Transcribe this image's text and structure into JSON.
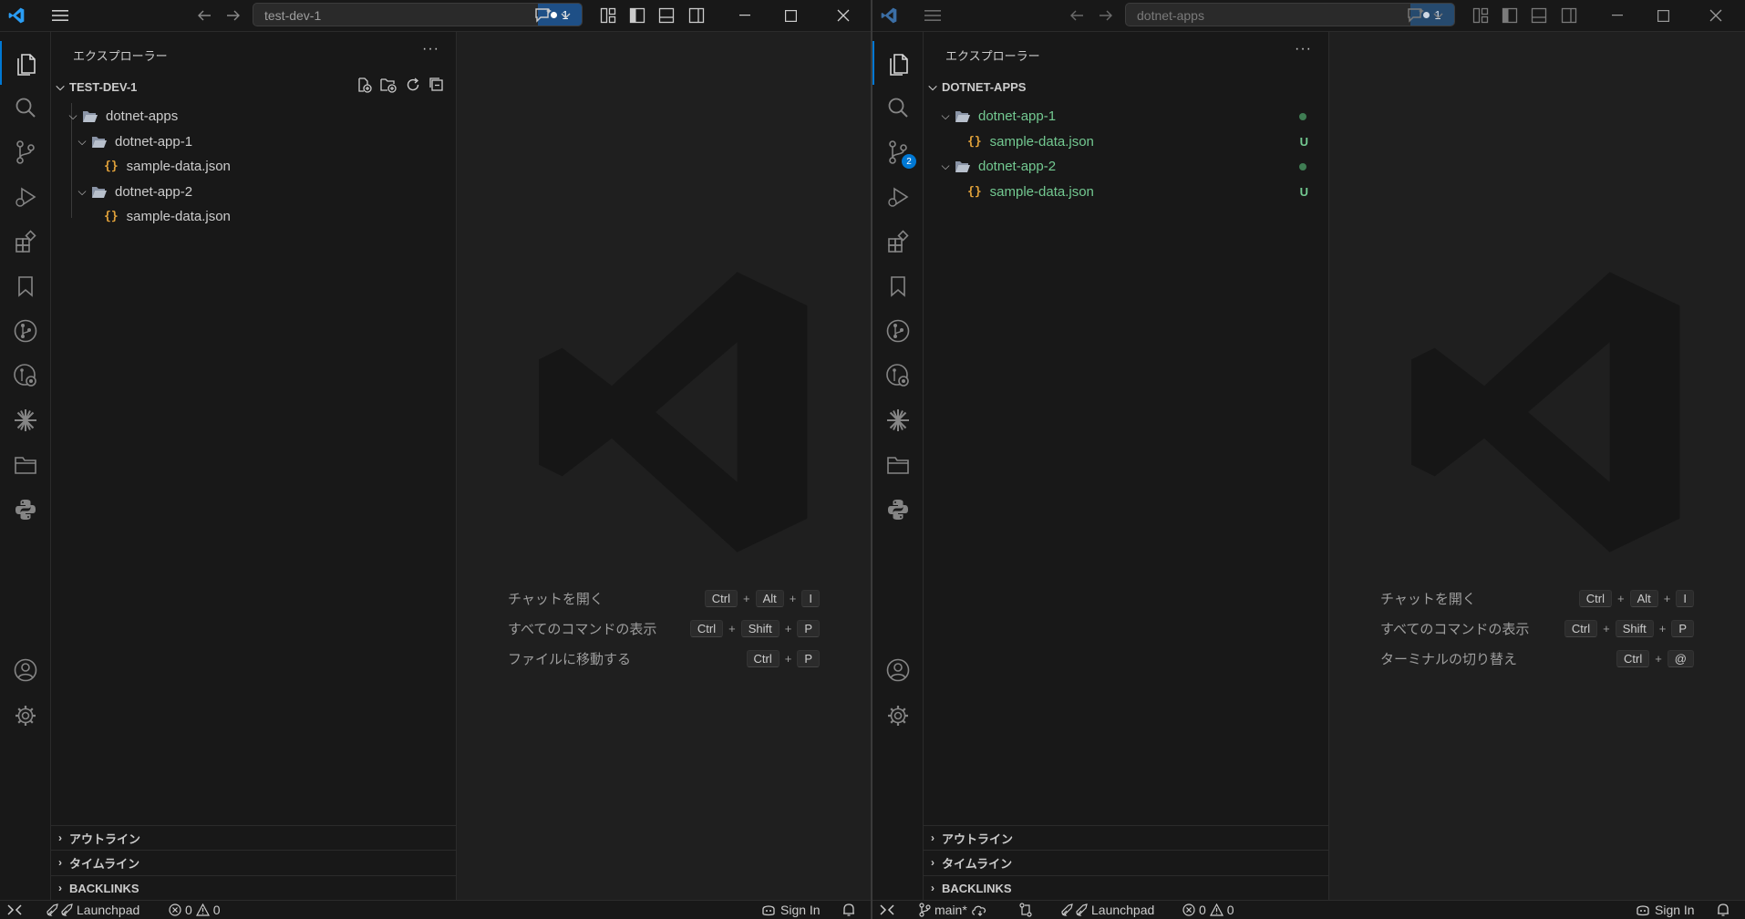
{
  "left": {
    "search_text": "test-dev-1",
    "chat_badge_count": "1",
    "sidebar_title": "エクスプローラー",
    "more": "···",
    "root_folder": "TEST-DEV-1",
    "tree": {
      "f0": "dotnet-apps",
      "f1": "dotnet-app-1",
      "f1_file": "sample-data.json",
      "f2": "dotnet-app-2",
      "f2_file": "sample-data.json"
    },
    "bottom_sections": [
      "アウトライン",
      "タイムライン",
      "BACKLINKS"
    ],
    "shortcuts": [
      {
        "label": "チャットを開く",
        "k1": "Ctrl",
        "k2": "Alt",
        "k3": "I"
      },
      {
        "label": "すべてのコマンドの表示",
        "k1": "Ctrl",
        "k2": "Shift",
        "k3": "P"
      },
      {
        "label": "ファイルに移動する",
        "k1": "Ctrl",
        "k2": "P"
      }
    ],
    "status": {
      "launchpad": "Launchpad",
      "errors": "0",
      "warnings": "0",
      "signin": "Sign In"
    }
  },
  "right": {
    "search_text": "dotnet-apps",
    "chat_badge_count": "1",
    "sidebar_title": "エクスプローラー",
    "more": "···",
    "root_folder": "DOTNET-APPS",
    "scm_badge": "2",
    "tree": {
      "f1": "dotnet-app-1",
      "f1_file": "sample-data.json",
      "f1_file_status": "U",
      "f2": "dotnet-app-2",
      "f2_file": "sample-data.json",
      "f2_file_status": "U"
    },
    "bottom_sections": [
      "アウトライン",
      "タイムライン",
      "BACKLINKS"
    ],
    "shortcuts": [
      {
        "label": "チャットを開く",
        "k1": "Ctrl",
        "k2": "Alt",
        "k3": "I"
      },
      {
        "label": "すべてのコマンドの表示",
        "k1": "Ctrl",
        "k2": "Shift",
        "k3": "P"
      },
      {
        "label": "ターミナルの切り替え",
        "k1": "Ctrl",
        "k2": "@"
      }
    ],
    "status": {
      "branch": "main*",
      "launchpad": "Launchpad",
      "errors": "0",
      "warnings": "0",
      "signin": "Sign In"
    }
  },
  "plus": "+",
  "colors": {
    "accent": "#0078d4",
    "untracked": "#73c991",
    "json_icon": "#e2a23a"
  }
}
